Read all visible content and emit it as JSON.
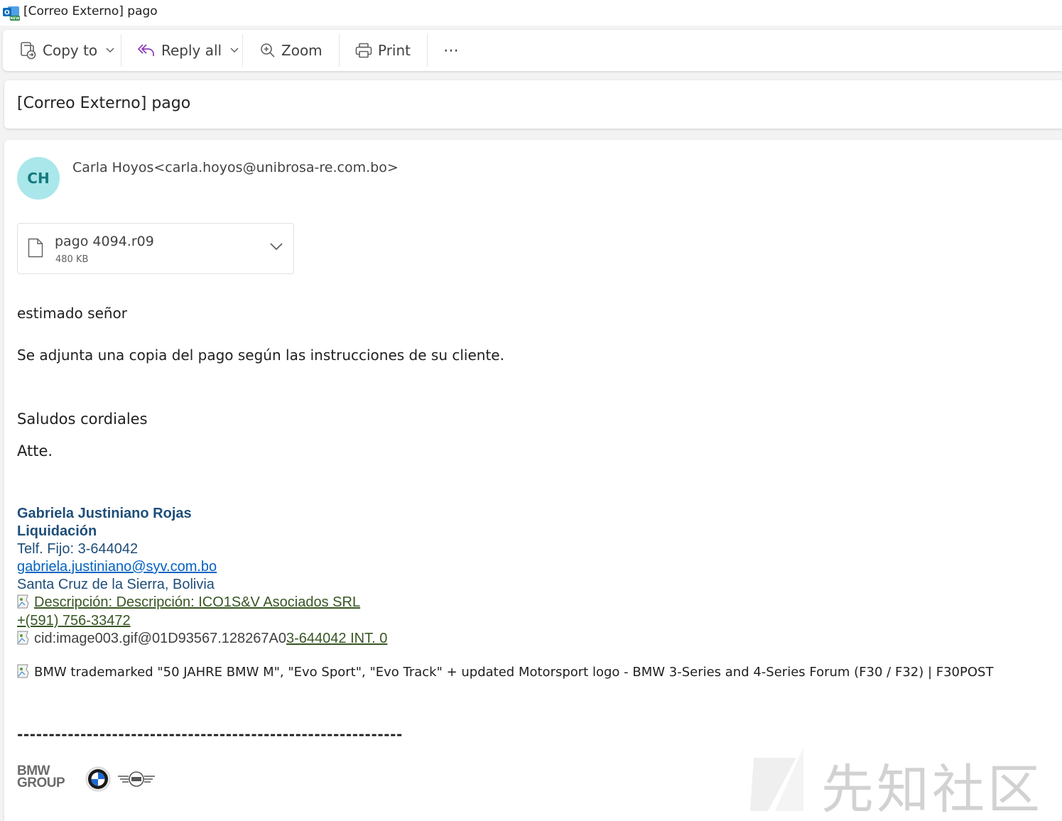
{
  "window": {
    "title": "[Correo Externo] pago",
    "app_icon": "outlook-new-icon"
  },
  "toolbar": {
    "copy_to": "Copy to",
    "reply_all": "Reply all",
    "zoom": "Zoom",
    "print": "Print",
    "more": "⋯"
  },
  "message": {
    "subject": "[Correo Externo] pago",
    "sender_initials": "CH",
    "sender": "Carla Hoyos<carla.hoyos@unibrosa-re.com.bo>",
    "avatar_color": "#a9e7ea",
    "attachment": {
      "name": "pago 4094.r09",
      "size": "480 KB"
    },
    "body": {
      "greeting": "estimado señor",
      "line1": "Se adjunta una copia del pago según las instrucciones de su cliente.",
      "closing": "Saludos cordiales",
      "atte": "Atte."
    },
    "signature": {
      "name": "Gabriela Justiniano Rojas",
      "department": "Liquidación",
      "phone": "Telf. Fijo: 3-644042",
      "email": "gabriela.justiniano@syv.com.bo",
      "location": "Santa Cruz de la Sierra, Bolivia",
      "logo_alt": "Descripción: Descripción: ICO1S&V Asociados SRL",
      "mobile": " +(591) 756-33472",
      "img_alt": "cid:image003.gif@01D93567.128267A0",
      "ext": "3-644042 INT. 0"
    },
    "bmw_alt": "BMW trademarked \"50 JAHRE BMW M\", \"Evo Sport\", \"Evo Track\" + updated Motorsport logo - BMW 3-Series and 4-Series Forum (F30 / F32) | F30POST",
    "dashes": "-------------------------------------------------------------",
    "bmw_group_logo": {
      "line1": "BMW",
      "line2": "GROUP"
    },
    "bmw_roundel": "bmw-roundel-logo",
    "mini_wings": "mini-wings-logo"
  },
  "watermark": "先知社区"
}
